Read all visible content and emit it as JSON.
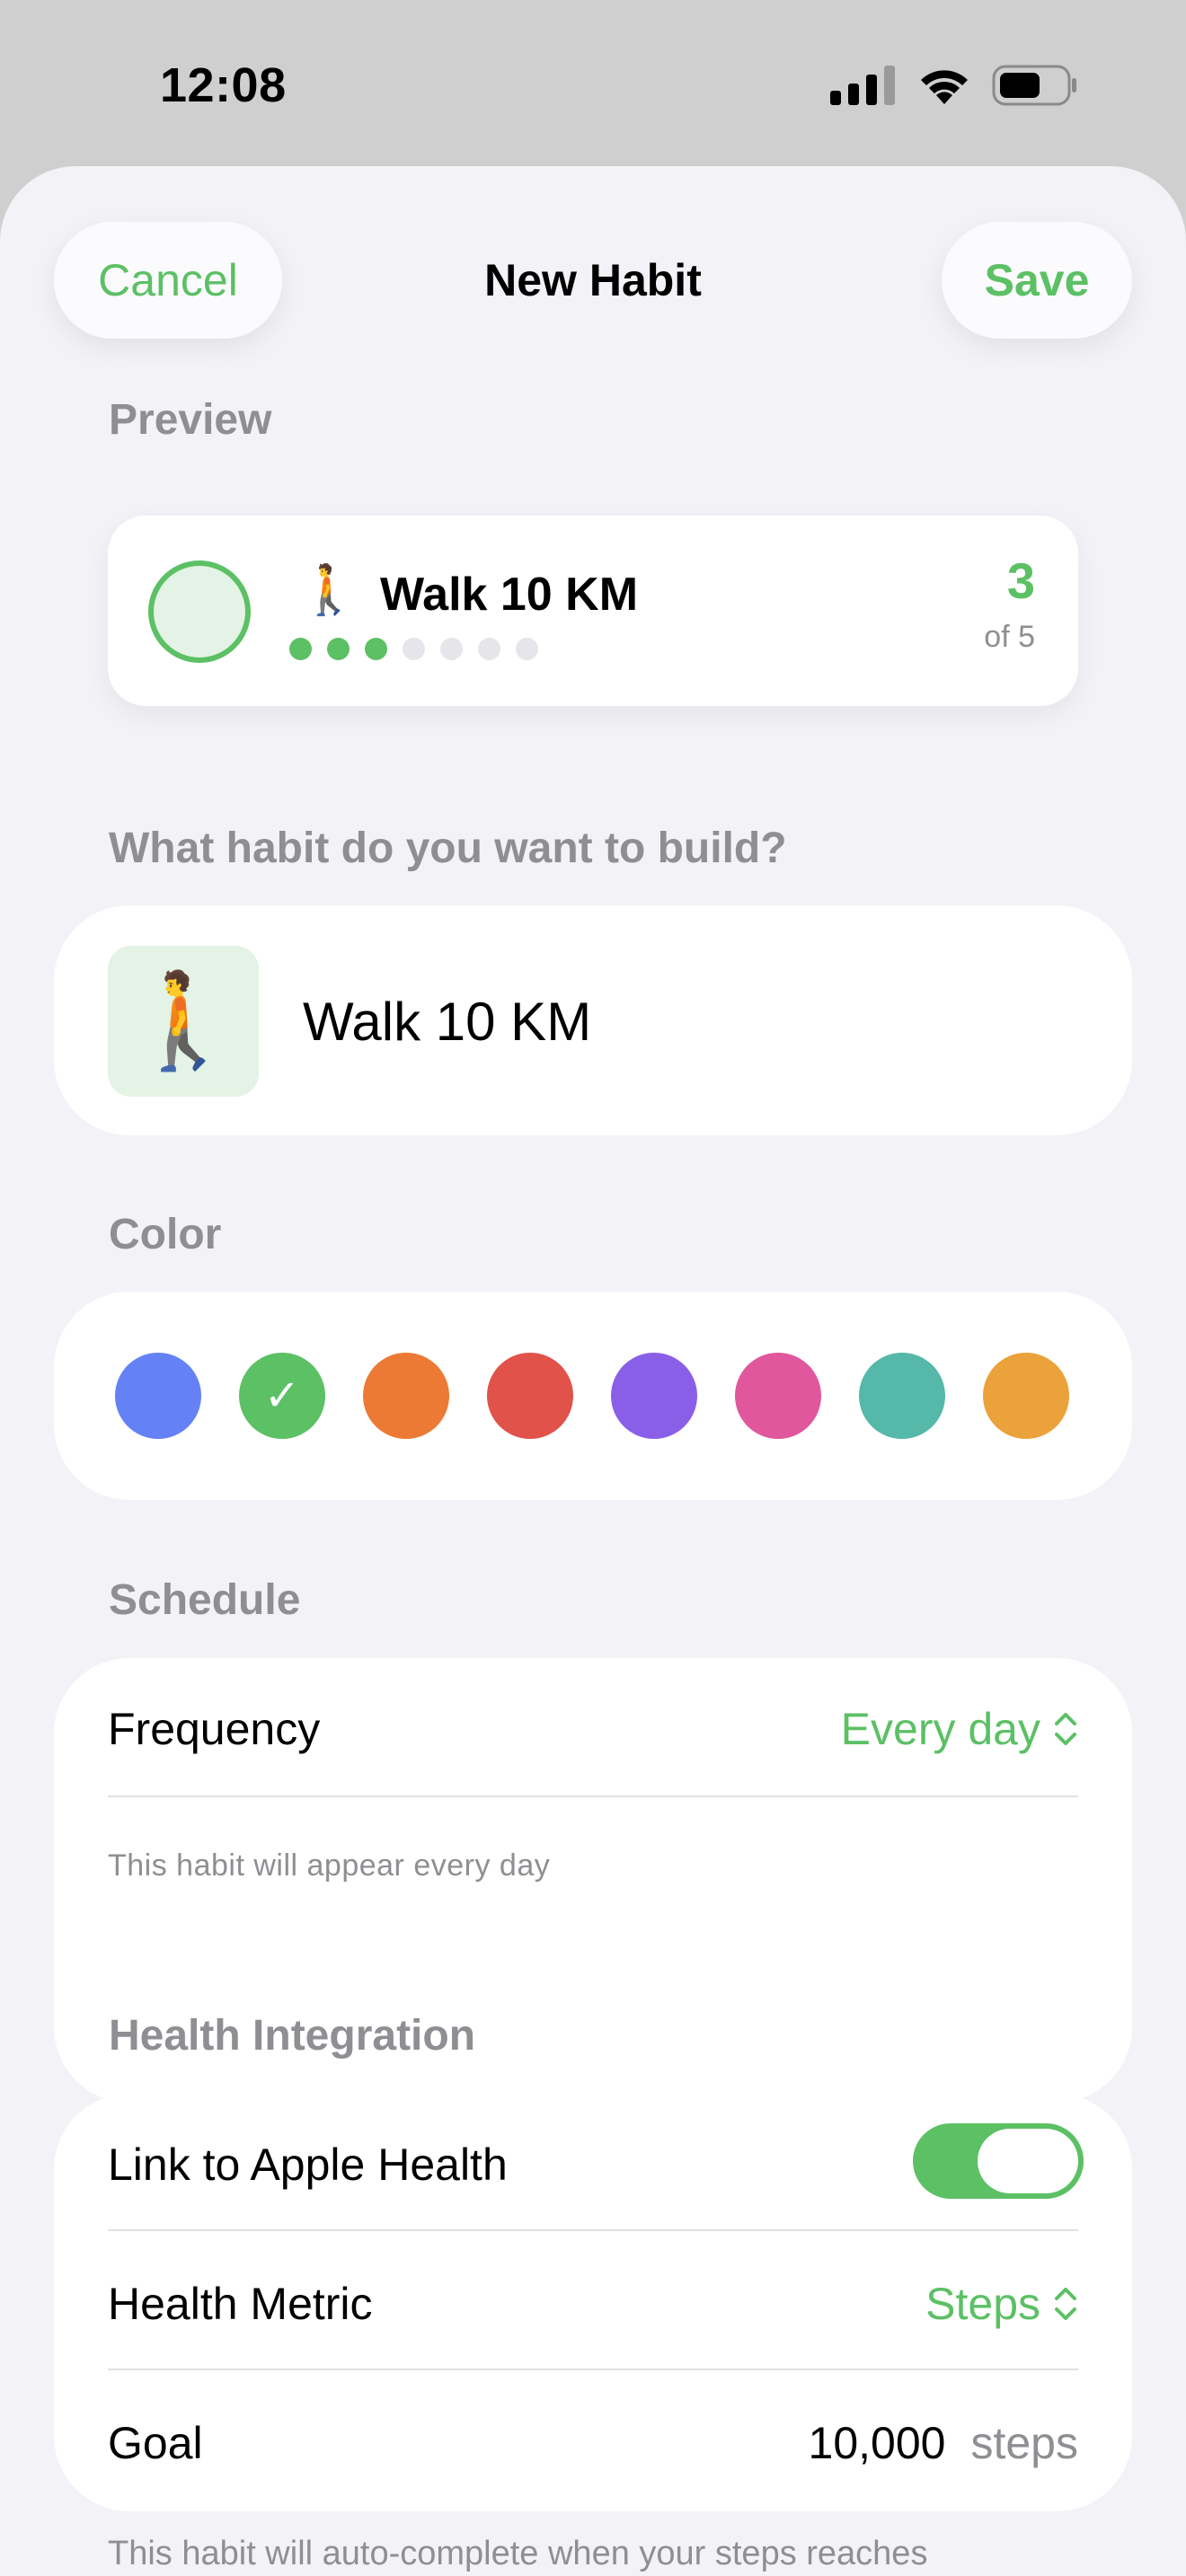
{
  "status_bar": {
    "time": "12:08"
  },
  "nav": {
    "cancel": "Cancel",
    "title": "New Habit",
    "save": "Save"
  },
  "preview": {
    "label": "Preview",
    "name": "Walk 10 KM",
    "emoji": "🚶",
    "count": "3",
    "of_text": "of 5",
    "progress": {
      "completed": 3,
      "total": 7
    }
  },
  "habit": {
    "question": "What habit do you want to build?",
    "emoji": "🚶",
    "name": "Walk 10 KM"
  },
  "color": {
    "label": "Color",
    "options": [
      "#6482f5",
      "#5cc065",
      "#ec7a35",
      "#e0524a",
      "#8a5fe8",
      "#e0579d",
      "#55b8a8",
      "#eba23a"
    ],
    "selected_index": 1,
    "check_glyph": "✓"
  },
  "schedule": {
    "label": "Schedule",
    "frequency_label": "Frequency",
    "frequency_value": "Every day",
    "hint": "This habit will appear every day"
  },
  "health": {
    "label": "Health Integration",
    "link_label": "Link to Apple Health",
    "link_enabled": true,
    "metric_label": "Health Metric",
    "metric_value": "Steps",
    "goal_label": "Goal",
    "goal_value": "10,000",
    "goal_unit": "steps",
    "note": "This habit will auto-complete when your steps reaches"
  },
  "colors": {
    "accent": "#5cc065",
    "secondary_text": "#8e8e93",
    "background": "#f2f2f7"
  }
}
